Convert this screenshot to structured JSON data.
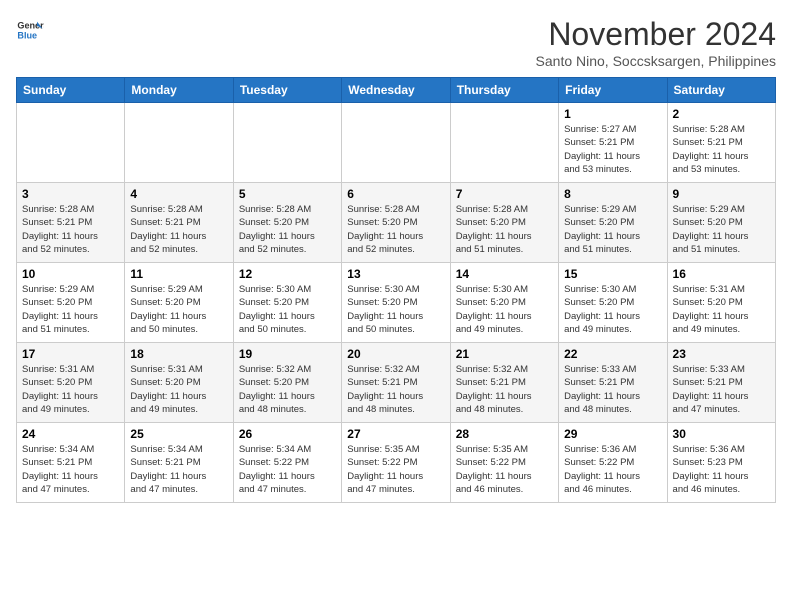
{
  "logo": {
    "line1": "General",
    "line2": "Blue"
  },
  "title": "November 2024",
  "subtitle": "Santo Nino, Soccsksargen, Philippines",
  "headers": [
    "Sunday",
    "Monday",
    "Tuesday",
    "Wednesday",
    "Thursday",
    "Friday",
    "Saturday"
  ],
  "weeks": [
    [
      {
        "day": "",
        "info": ""
      },
      {
        "day": "",
        "info": ""
      },
      {
        "day": "",
        "info": ""
      },
      {
        "day": "",
        "info": ""
      },
      {
        "day": "",
        "info": ""
      },
      {
        "day": "1",
        "info": "Sunrise: 5:27 AM\nSunset: 5:21 PM\nDaylight: 11 hours\nand 53 minutes."
      },
      {
        "day": "2",
        "info": "Sunrise: 5:28 AM\nSunset: 5:21 PM\nDaylight: 11 hours\nand 53 minutes."
      }
    ],
    [
      {
        "day": "3",
        "info": "Sunrise: 5:28 AM\nSunset: 5:21 PM\nDaylight: 11 hours\nand 52 minutes."
      },
      {
        "day": "4",
        "info": "Sunrise: 5:28 AM\nSunset: 5:21 PM\nDaylight: 11 hours\nand 52 minutes."
      },
      {
        "day": "5",
        "info": "Sunrise: 5:28 AM\nSunset: 5:20 PM\nDaylight: 11 hours\nand 52 minutes."
      },
      {
        "day": "6",
        "info": "Sunrise: 5:28 AM\nSunset: 5:20 PM\nDaylight: 11 hours\nand 52 minutes."
      },
      {
        "day": "7",
        "info": "Sunrise: 5:28 AM\nSunset: 5:20 PM\nDaylight: 11 hours\nand 51 minutes."
      },
      {
        "day": "8",
        "info": "Sunrise: 5:29 AM\nSunset: 5:20 PM\nDaylight: 11 hours\nand 51 minutes."
      },
      {
        "day": "9",
        "info": "Sunrise: 5:29 AM\nSunset: 5:20 PM\nDaylight: 11 hours\nand 51 minutes."
      }
    ],
    [
      {
        "day": "10",
        "info": "Sunrise: 5:29 AM\nSunset: 5:20 PM\nDaylight: 11 hours\nand 51 minutes."
      },
      {
        "day": "11",
        "info": "Sunrise: 5:29 AM\nSunset: 5:20 PM\nDaylight: 11 hours\nand 50 minutes."
      },
      {
        "day": "12",
        "info": "Sunrise: 5:30 AM\nSunset: 5:20 PM\nDaylight: 11 hours\nand 50 minutes."
      },
      {
        "day": "13",
        "info": "Sunrise: 5:30 AM\nSunset: 5:20 PM\nDaylight: 11 hours\nand 50 minutes."
      },
      {
        "day": "14",
        "info": "Sunrise: 5:30 AM\nSunset: 5:20 PM\nDaylight: 11 hours\nand 49 minutes."
      },
      {
        "day": "15",
        "info": "Sunrise: 5:30 AM\nSunset: 5:20 PM\nDaylight: 11 hours\nand 49 minutes."
      },
      {
        "day": "16",
        "info": "Sunrise: 5:31 AM\nSunset: 5:20 PM\nDaylight: 11 hours\nand 49 minutes."
      }
    ],
    [
      {
        "day": "17",
        "info": "Sunrise: 5:31 AM\nSunset: 5:20 PM\nDaylight: 11 hours\nand 49 minutes."
      },
      {
        "day": "18",
        "info": "Sunrise: 5:31 AM\nSunset: 5:20 PM\nDaylight: 11 hours\nand 49 minutes."
      },
      {
        "day": "19",
        "info": "Sunrise: 5:32 AM\nSunset: 5:20 PM\nDaylight: 11 hours\nand 48 minutes."
      },
      {
        "day": "20",
        "info": "Sunrise: 5:32 AM\nSunset: 5:21 PM\nDaylight: 11 hours\nand 48 minutes."
      },
      {
        "day": "21",
        "info": "Sunrise: 5:32 AM\nSunset: 5:21 PM\nDaylight: 11 hours\nand 48 minutes."
      },
      {
        "day": "22",
        "info": "Sunrise: 5:33 AM\nSunset: 5:21 PM\nDaylight: 11 hours\nand 48 minutes."
      },
      {
        "day": "23",
        "info": "Sunrise: 5:33 AM\nSunset: 5:21 PM\nDaylight: 11 hours\nand 47 minutes."
      }
    ],
    [
      {
        "day": "24",
        "info": "Sunrise: 5:34 AM\nSunset: 5:21 PM\nDaylight: 11 hours\nand 47 minutes."
      },
      {
        "day": "25",
        "info": "Sunrise: 5:34 AM\nSunset: 5:21 PM\nDaylight: 11 hours\nand 47 minutes."
      },
      {
        "day": "26",
        "info": "Sunrise: 5:34 AM\nSunset: 5:22 PM\nDaylight: 11 hours\nand 47 minutes."
      },
      {
        "day": "27",
        "info": "Sunrise: 5:35 AM\nSunset: 5:22 PM\nDaylight: 11 hours\nand 47 minutes."
      },
      {
        "day": "28",
        "info": "Sunrise: 5:35 AM\nSunset: 5:22 PM\nDaylight: 11 hours\nand 46 minutes."
      },
      {
        "day": "29",
        "info": "Sunrise: 5:36 AM\nSunset: 5:22 PM\nDaylight: 11 hours\nand 46 minutes."
      },
      {
        "day": "30",
        "info": "Sunrise: 5:36 AM\nSunset: 5:23 PM\nDaylight: 11 hours\nand 46 minutes."
      }
    ]
  ]
}
